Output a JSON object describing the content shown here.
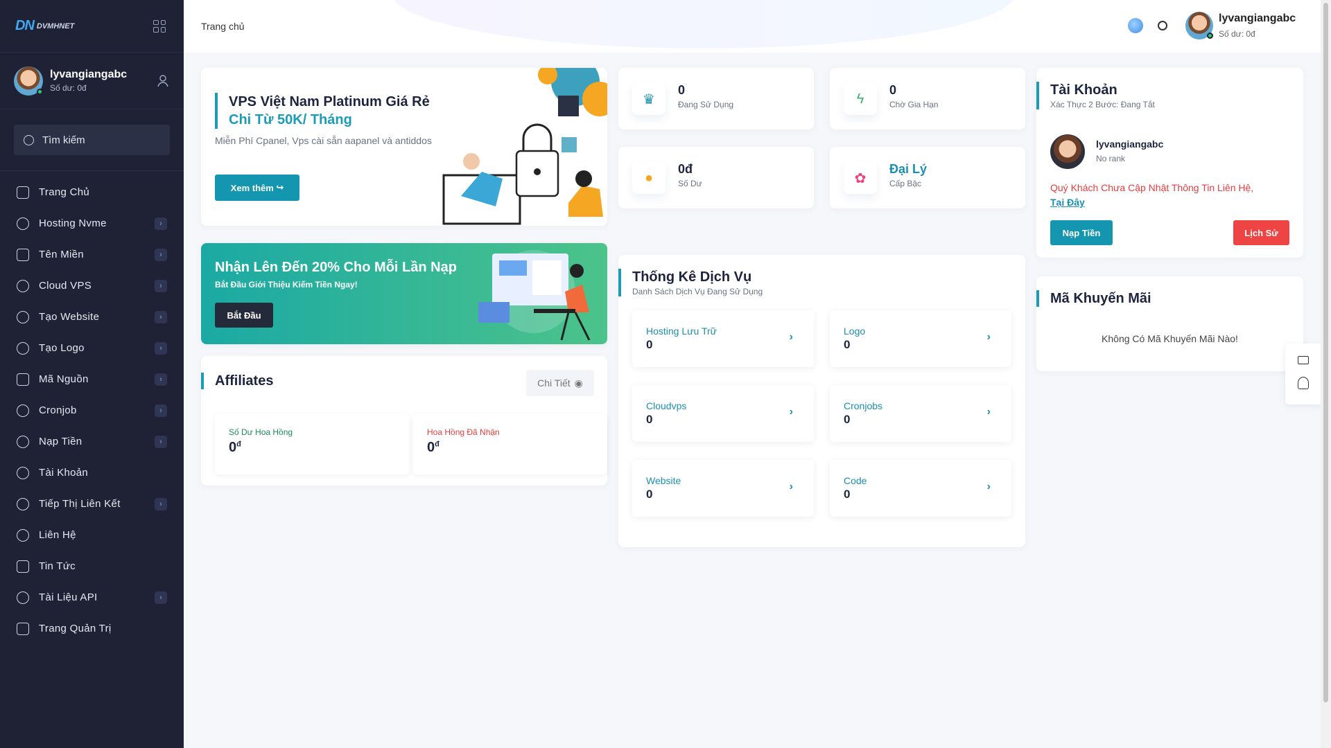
{
  "brand": {
    "logo_mark": "DN",
    "logo_text": "DVMHNET"
  },
  "sidebar": {
    "user": {
      "name": "lyvangiangabc",
      "balance": "Số dư: 0đ"
    },
    "search": {
      "placeholder": "Tìm kiếm"
    },
    "items": [
      {
        "label": "Trang Chủ",
        "icon": "home-icon",
        "arrow": false
      },
      {
        "label": "Hosting Nvme",
        "icon": "infinity-icon",
        "arrow": true
      },
      {
        "label": "Tên Miền",
        "icon": "domain-search-icon",
        "arrow": true
      },
      {
        "label": "Cloud VPS",
        "icon": "cloud-icon",
        "arrow": true
      },
      {
        "label": "Tạo Website",
        "icon": "globe-icon",
        "arrow": true
      },
      {
        "label": "Tạo Logo",
        "icon": "palette-icon",
        "arrow": true
      },
      {
        "label": "Mã Nguồn",
        "icon": "code-file-icon",
        "arrow": true
      },
      {
        "label": "Cronjob",
        "icon": "clock-icon",
        "arrow": true
      },
      {
        "label": "Nạp Tiền",
        "icon": "coin-icon",
        "arrow": true
      },
      {
        "label": "Tài Khoản",
        "icon": "user-icon",
        "arrow": false
      },
      {
        "label": "Tiếp Thị Liên Kết",
        "icon": "share-icon",
        "arrow": true
      },
      {
        "label": "Liên Hệ",
        "icon": "phone-icon",
        "arrow": false
      },
      {
        "label": "Tin Tức",
        "icon": "news-icon",
        "arrow": false
      },
      {
        "label": "Tài Liệu API",
        "icon": "gear-icon",
        "arrow": true
      },
      {
        "label": "Trang Quản Trị",
        "icon": "admin-nodes-icon",
        "arrow": false
      }
    ]
  },
  "header": {
    "breadcrumb": "Trang chủ",
    "user": {
      "name": "lyvangiangabc",
      "balance": "Số dư: 0đ"
    }
  },
  "promo_vps": {
    "title_line1": "VPS Việt Nam Platinum Giá Rẻ",
    "title_line2": "Chi Từ 50K/ Tháng",
    "description": "Miễn Phí Cpanel, Vps cài sẵn aapanel và antiddos",
    "button": "Xem thêm"
  },
  "promo_topup": {
    "title": "Nhận Lên Đến 20% Cho Mỗi Lần Nạp",
    "subtitle": "Bắt Đầu Giới Thiệu Kiếm Tiền Ngay!",
    "button": "Bắt Đầu"
  },
  "affiliates": {
    "title": "Affiliates",
    "detail_button": "Chi Tiết",
    "boxes": [
      {
        "label": "Số Dư Hoa Hồng",
        "value": "0",
        "unit": "đ",
        "color": "#1b8a5a"
      },
      {
        "label": "Hoa Hồng Đã Nhận",
        "value": "0",
        "unit": "đ",
        "color": "#e53e3e"
      }
    ]
  },
  "stats": [
    {
      "value": "0",
      "label": "Đang Sử Dụng",
      "icon": "crown-icon",
      "color": "#1b8fb0"
    },
    {
      "value": "0",
      "label": "Chờ Gia Hạn",
      "icon": "lightning-icon",
      "color": "#3bb26b"
    },
    {
      "value": "0đ",
      "label": "Số Dư",
      "icon": "coins-icon",
      "color": "#f5a623"
    },
    {
      "value": "Đại Lý",
      "label": "Cấp Bậc",
      "icon": "rank-icon",
      "color": "#e8457a"
    }
  ],
  "services": {
    "title": "Thống Kê Dịch Vụ",
    "subtitle": "Danh Sách Dịch Vụ Đang Sử Dụng",
    "items": [
      {
        "name": "Hosting Lưu Trữ",
        "count": "0"
      },
      {
        "name": "Logo",
        "count": "0"
      },
      {
        "name": "Cloudvps",
        "count": "0"
      },
      {
        "name": "Cronjobs",
        "count": "0"
      },
      {
        "name": "Website",
        "count": "0"
      },
      {
        "name": "Code",
        "count": "0"
      }
    ]
  },
  "account": {
    "title": "Tài Khoản",
    "subtitle": "Xác Thực 2 Bước: Đang Tắt",
    "name": "lyvangiangabc",
    "rank": "No rank",
    "warning": "Quý Khách Chưa Cập Nhật Thông Tin Liên Hệ,",
    "warning_link": "Tại Đây",
    "btn_topup": "Nạp Tiền",
    "btn_history": "Lịch Sử"
  },
  "promo_codes": {
    "title": "Mã Khuyến Mãi",
    "empty": "Không Có Mã Khuyến Mãi Nào!"
  }
}
